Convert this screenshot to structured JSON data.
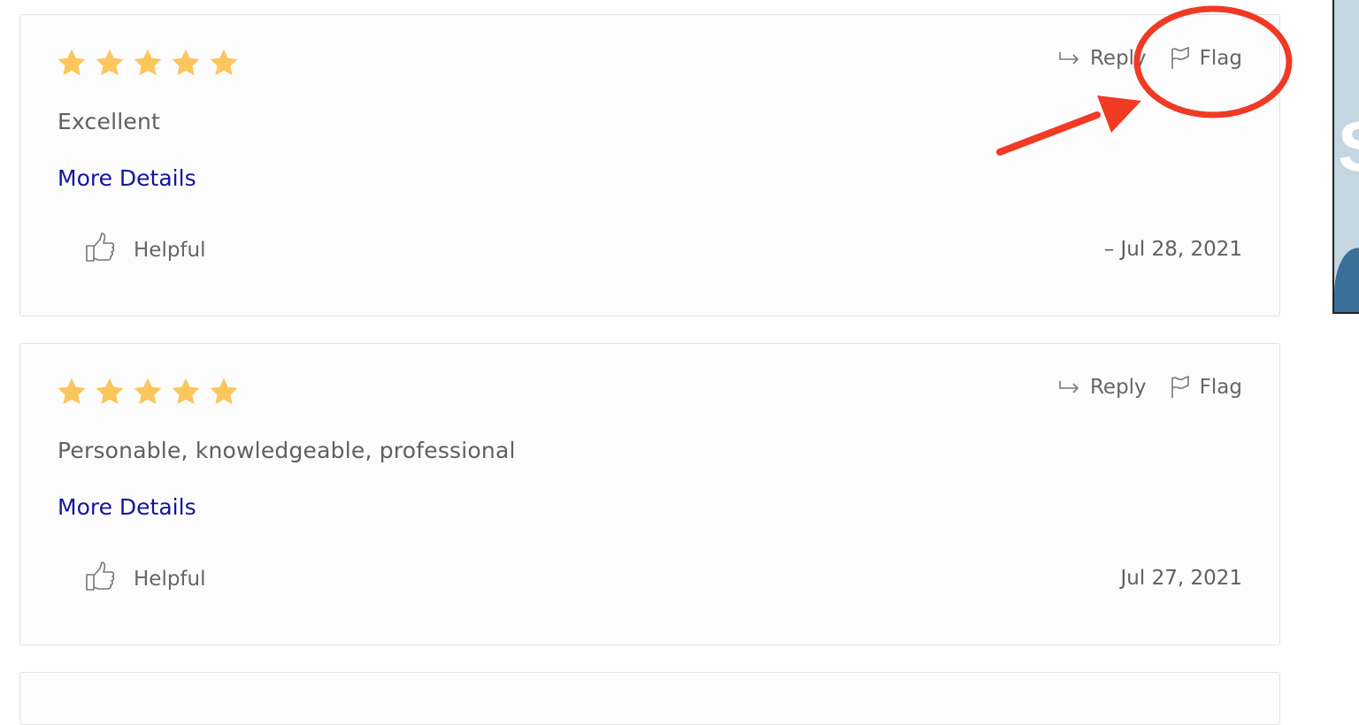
{
  "reviews": [
    {
      "rating": 5,
      "max_rating": 5,
      "text": "Excellent",
      "more_details": "More Details",
      "helpful": "Helpful",
      "date": "– Jul 28, 2021",
      "reply": "Reply",
      "flag": "Flag"
    },
    {
      "rating": 5,
      "max_rating": 5,
      "text": "Personable, knowledgeable, professional",
      "more_details": "More Details",
      "helpful": "Helpful",
      "date": "Jul 27, 2021",
      "reply": "Reply",
      "flag": "Flag"
    }
  ],
  "side_panel": {
    "letter": "S"
  },
  "annotation": {
    "target": "flag-button",
    "color": "#f03a24"
  },
  "colors": {
    "star": "#fcc65c",
    "link": "#15159c",
    "text": "#5d5d5d"
  }
}
